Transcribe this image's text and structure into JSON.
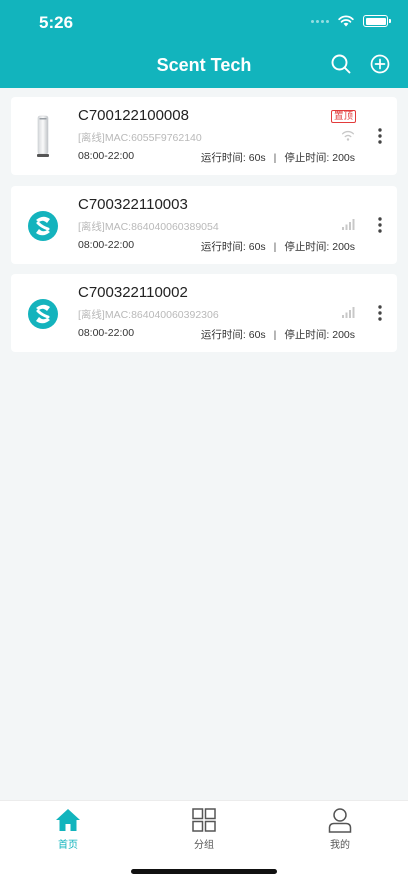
{
  "status_bar": {
    "time": "5:26"
  },
  "header": {
    "title": "Scent Tech"
  },
  "devices": [
    {
      "name": "C700122100008",
      "mac": "[离线]MAC:6055F9762140",
      "hours": "08:00-22:00",
      "run_time": "运行时间: 60s",
      "separator": "|",
      "stop_time": "停止时间: 200s",
      "pin_badge": "置顶",
      "connection": "wifi-icon",
      "thumbnail": "diffuser-tower"
    },
    {
      "name": "C700322110003",
      "mac": "[离线]MAC:864040060389054",
      "hours": "08:00-22:00",
      "run_time": "运行时间: 60s",
      "separator": "|",
      "stop_time": "停止时间: 200s",
      "connection": "cellular-signal-icon",
      "thumbnail": "scent-tech-logo"
    },
    {
      "name": "C700322110002",
      "mac": "[离线]MAC:864040060392306",
      "hours": "08:00-22:00",
      "run_time": "运行时间: 60s",
      "separator": "|",
      "stop_time": "停止时间: 200s",
      "connection": "cellular-signal-icon",
      "thumbnail": "scent-tech-logo"
    }
  ],
  "tabs": [
    {
      "label": "首页",
      "icon": "home-icon",
      "active": true
    },
    {
      "label": "分组",
      "icon": "grid-icon",
      "active": false
    },
    {
      "label": "我的",
      "icon": "user-icon",
      "active": false
    }
  ],
  "colors": {
    "brand": "#12b4bd",
    "pin_badge": "#e23b3b",
    "offline_text": "#b9b9b9"
  }
}
